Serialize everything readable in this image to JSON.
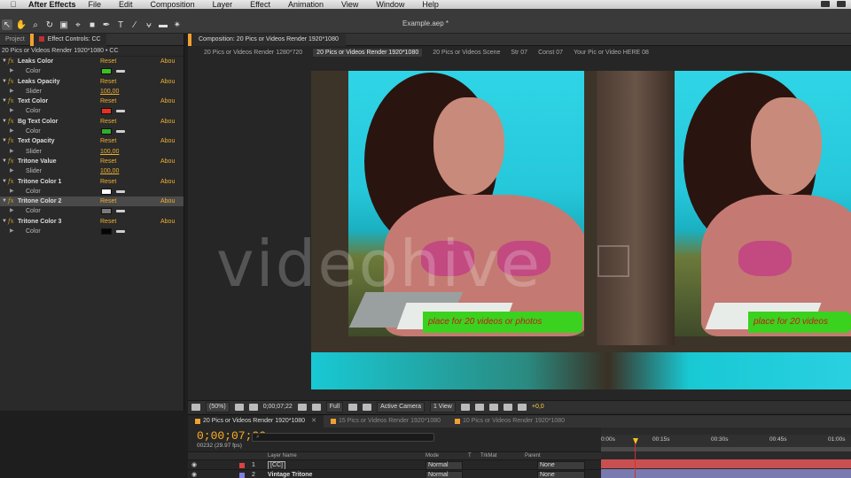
{
  "menubar": {
    "app_name": "After Effects",
    "items": [
      "File",
      "Edit",
      "Composition",
      "Layer",
      "Effect",
      "Animation",
      "View",
      "Window",
      "Help"
    ]
  },
  "toolbar": {
    "document_title": "Example.aep *"
  },
  "left_panel": {
    "tabs": [
      "Project",
      "Effect Controls: CC"
    ],
    "effect_path": "20 Pics or Videos Render 1920*1080 • CC",
    "effects": [
      {
        "name": "Leaks Color",
        "reset": "Reset",
        "about": "Abou",
        "prop": "Color",
        "swatch": "#3bc21f"
      },
      {
        "name": "Leaks Opacity",
        "reset": "Reset",
        "about": "Abou",
        "prop": "Slider",
        "value": "100,00"
      },
      {
        "name": "Text Color",
        "reset": "Reset",
        "about": "Abou",
        "prop": "Color",
        "swatch": "#e83020"
      },
      {
        "name": "Bg Text Color",
        "reset": "Reset",
        "about": "Abou",
        "prop": "Color",
        "swatch": "#2fae28"
      },
      {
        "name": "Text Opacity",
        "reset": "Reset",
        "about": "Abou",
        "prop": "Slider",
        "value": "100,00"
      },
      {
        "name": "Tritone Value",
        "reset": "Reset",
        "about": "Abou",
        "prop": "Slider",
        "value": "100,00"
      },
      {
        "name": "Tritone Color 1",
        "reset": "Reset",
        "about": "Abou",
        "prop": "Color",
        "swatch": "#ffffff"
      },
      {
        "name": "Tritone Color 2",
        "reset": "Reset",
        "about": "Abou",
        "prop": "Color",
        "swatch": "#7a7a7a"
      },
      {
        "name": "Tritone Color 3",
        "reset": "Reset",
        "about": "Abou",
        "prop": "Color",
        "swatch": "#050505"
      }
    ]
  },
  "comp_panel": {
    "tab": "Composition: 20 Pics or Videos Render 1920*1080",
    "flow": [
      "20 Pics or Videos Render 1280*720",
      "20 Pics or Videos Render 1920*1080",
      "20 Pics or Videos Scene",
      "Str 07",
      "Const 07",
      "Your Pic or Video HERE 08"
    ],
    "caption_left": "place for 20 videos or photos",
    "caption_right": "place for 20 videos",
    "watermark": "videohive",
    "viewer_bar": {
      "zoom": "(50%)",
      "timecode": "0;00;07;22",
      "resolution": "Full",
      "camera": "Active Camera",
      "views": "1 View",
      "offset": "+0,0"
    }
  },
  "timeline": {
    "tabs": [
      {
        "label": "20 Pics or Videos Render 1920*1080",
        "active": true
      },
      {
        "label": "15 Pics or Videos Render 1920*1080",
        "active": false
      },
      {
        "label": "10 Pics or Videos Render 1920*1080",
        "active": false
      }
    ],
    "timecode": "0;00;07;22",
    "fps": "00232 (29.97 fps)",
    "search_placeholder": "⌕",
    "columns": {
      "layer_name": "Layer Name",
      "mode": "Mode",
      "t": "T",
      "trkmat": "TrkMat",
      "parent": "Parent"
    },
    "ruler": [
      "0:00s",
      "00:15s",
      "00:30s",
      "00:45s",
      "01:00s"
    ],
    "layers": [
      {
        "num": "1",
        "name": "[CC]",
        "mode": "Normal",
        "parent": "None",
        "label_color": "#e04040",
        "bar_color": "#c85050"
      },
      {
        "num": "2",
        "name": "Vintage Tritone",
        "mode": "Normal",
        "parent": "None",
        "label_color": "#8080e0",
        "bar_color": "#7a7ab0"
      }
    ]
  }
}
